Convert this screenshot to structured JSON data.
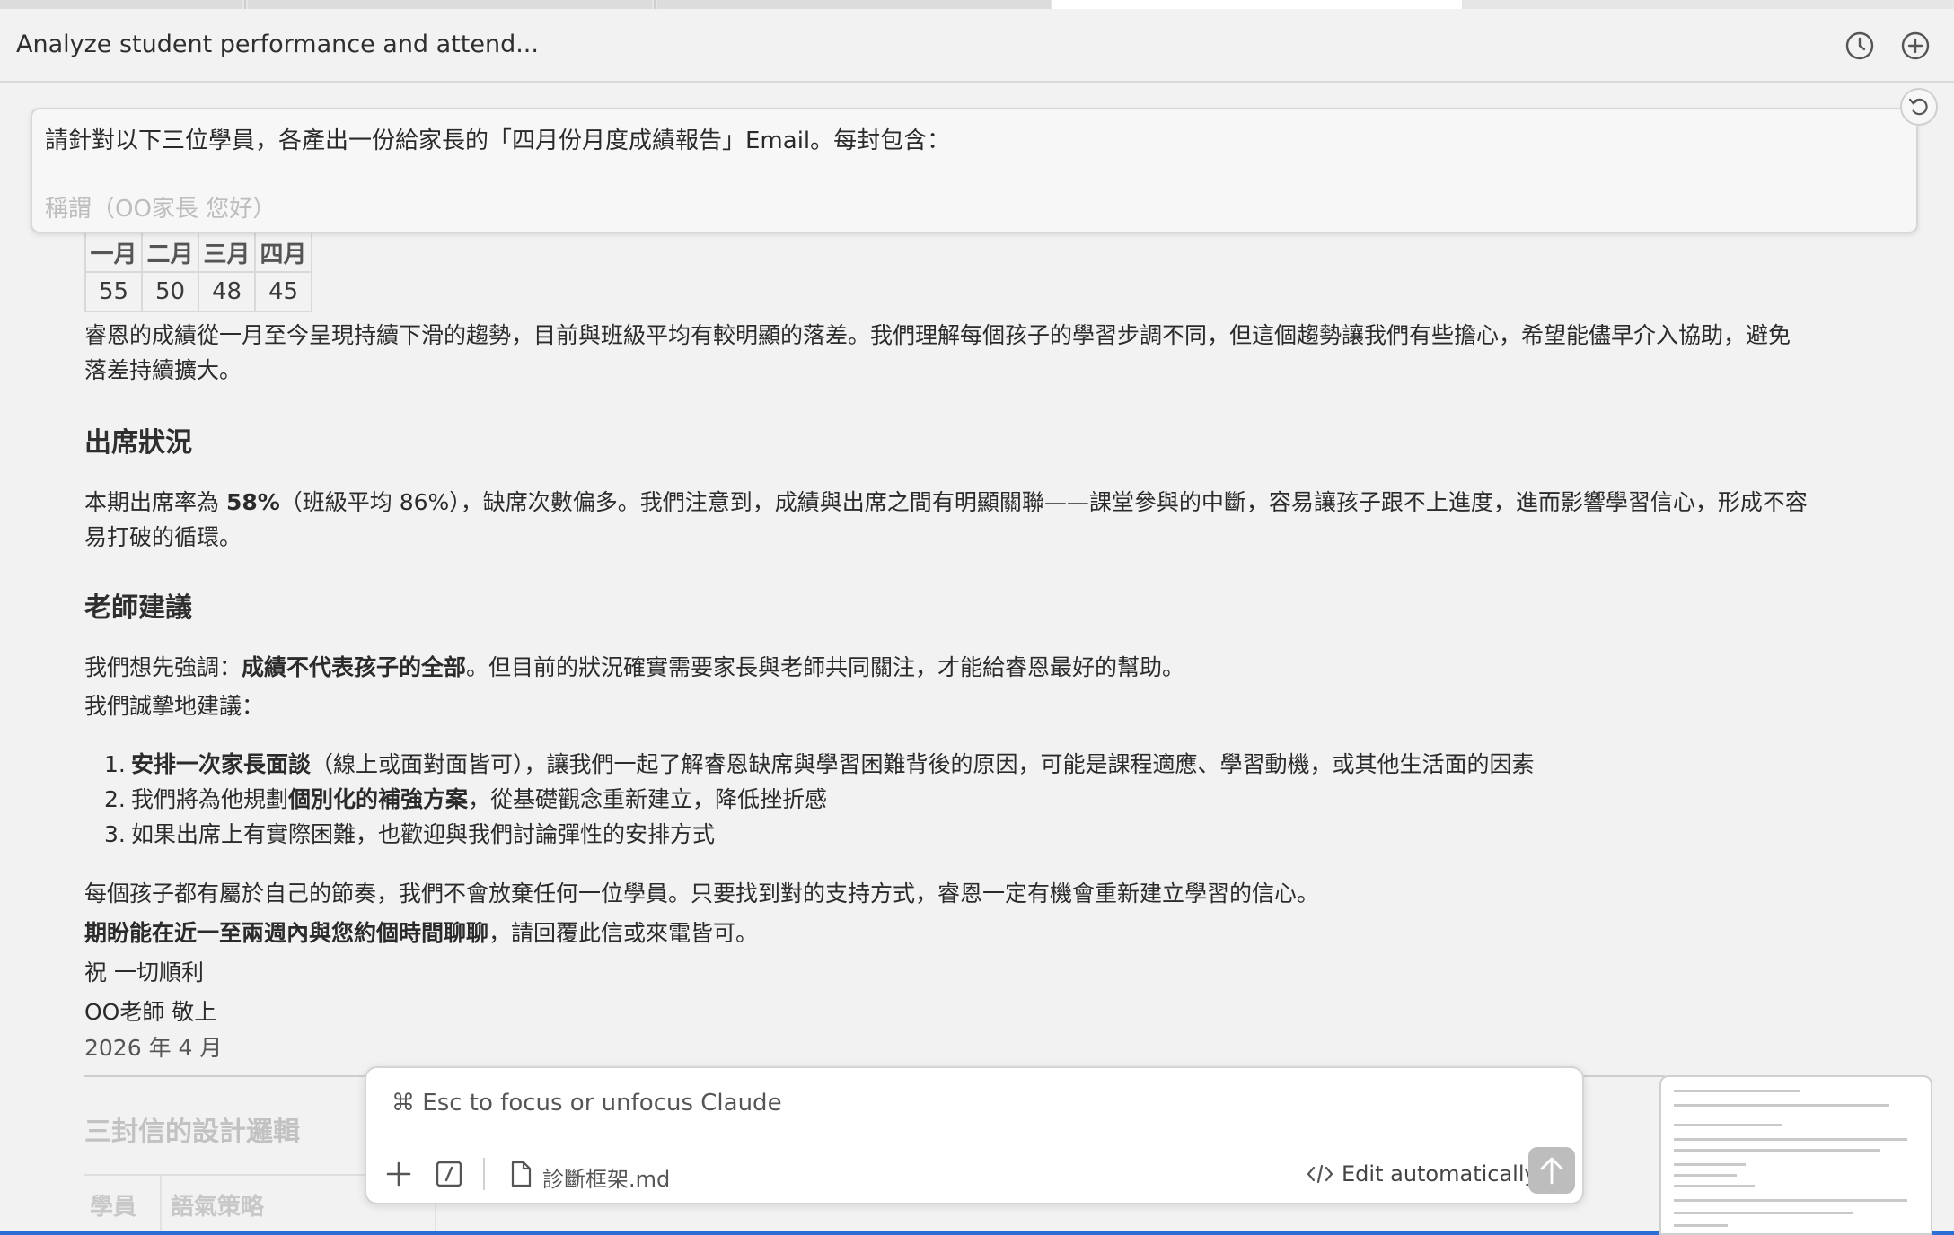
{
  "header": {
    "title": "Analyze student performance and attend..."
  },
  "prompt": {
    "line1": "請針對以下三位學員，各產出一份給家長的「四月份月度成績報告」Email。每封包含：",
    "line2": "稱謂（OO家長 您好）"
  },
  "grades": {
    "months": [
      "一月",
      "二月",
      "三月",
      "四月"
    ],
    "scores": [
      "55",
      "50",
      "48",
      "45"
    ]
  },
  "content": {
    "trend_paragraph_1": "睿恩的成績從一月至今呈現持續下滑的趨勢，目前與班級平均有較明顯的落差。我們理解每個孩子的學習步調不同，但這個趨勢讓我們有些擔心，希望能儘早介入協助，避免",
    "trend_paragraph_2": "落差持續擴大。",
    "attendance_heading": "出席狀況",
    "attendance_pre": "本期出席率為 ",
    "attendance_rate": "58%",
    "attendance_post": "（班級平均 86%），缺席次數偏多。我們注意到，成績與出席之間有明顯關聯——課堂參與的中斷，容易讓孩子跟不上進度，進而影響學習信心，形成不容",
    "attendance_line2": "易打破的循環。",
    "advice_heading": "老師建議",
    "advice_pre": "我們想先強調：",
    "advice_bold": "成績不代表孩子的全部",
    "advice_post": "。但目前的狀況確實需要家長與老師共同關注，才能給睿恩最好的幫助。",
    "advice_intro": "我們誠摯地建議：",
    "rec1_num": "1.",
    "rec1_bold": "安排一次家長面談",
    "rec1_rest": "（線上或面對面皆可），讓我們一起了解睿恩缺席與學習困難背後的原因，可能是課程適應、學習動機，或其他生活面的因素",
    "rec2_num": "2.",
    "rec2_pre": "我們將為他規劃",
    "rec2_bold": "個別化的補強方案",
    "rec2_rest": "，從基礎觀念重新建立，降低挫折感",
    "rec3_num": "3.",
    "rec3_text": "如果出席上有實際困難，也歡迎與我們討論彈性的安排方式",
    "closing_1": "每個孩子都有屬於自己的節奏，我們不會放棄任何一位學員。只要找到對的支持方式，睿恩一定有機會重新建立學習的信心。",
    "closing_bold": "期盼能在近一至兩週內與您約個時間聊聊",
    "closing_2_rest": "，請回覆此信或來電皆可。",
    "sign_1": "祝 一切順利",
    "sign_2": "OO老師 敬上",
    "sign_date": "2026 年 4 月",
    "next_heading": "三封信的設計邏輯",
    "next_col1": "學員",
    "next_col2": "語氣策略"
  },
  "composer": {
    "placeholder": "⌘ Esc to focus or unfocus Claude",
    "file_name": "診斷框架.md",
    "edit_mode": "Edit automatically"
  },
  "icons": {
    "history": "clock-icon",
    "new_chat": "plus-circle-icon",
    "undo": "undo-icon",
    "add": "plus-icon",
    "slash": "slash-command-icon",
    "file": "file-icon",
    "code": "code-icon",
    "send": "arrow-up-icon"
  },
  "colors": {
    "accent_bottom_bar": "#2b6fd6",
    "send_button_disabled": "#bdbdbd"
  }
}
